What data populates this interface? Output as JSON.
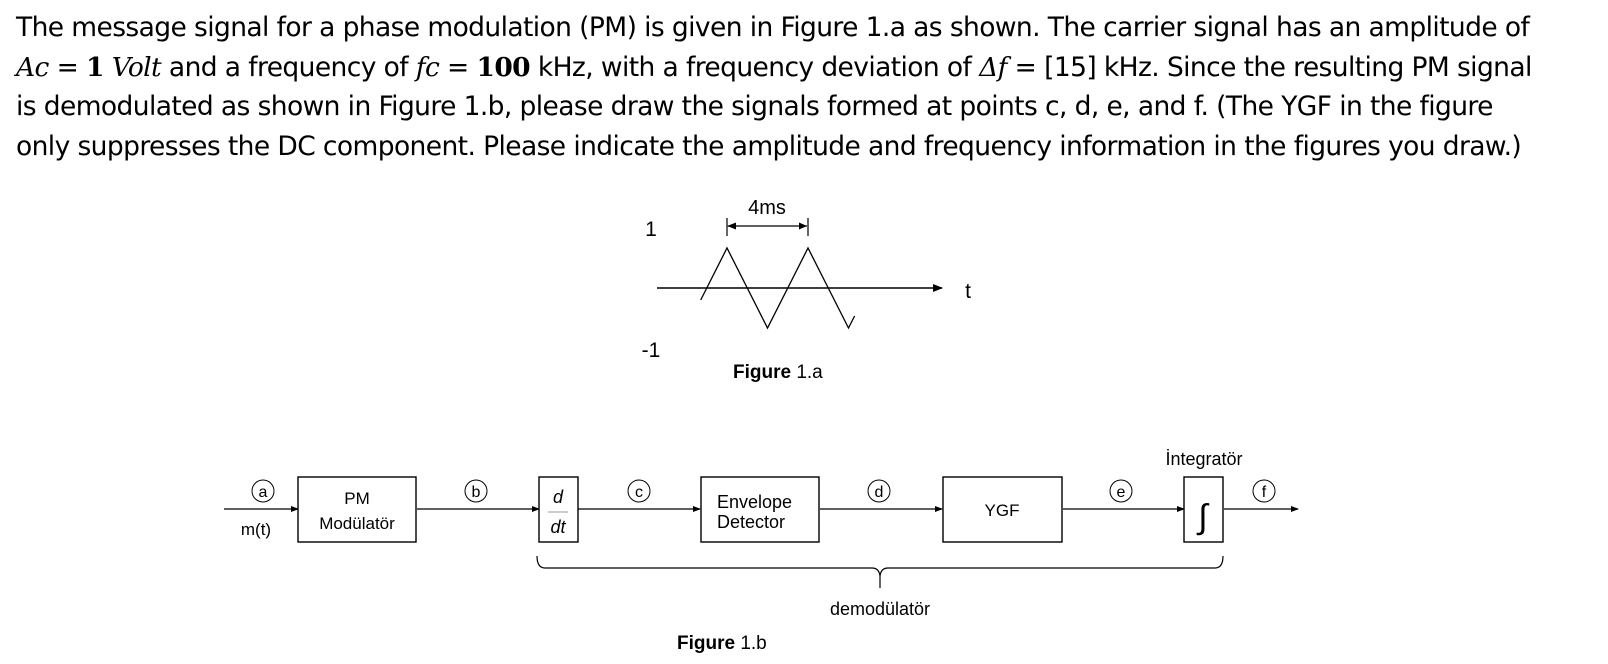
{
  "problem": {
    "line1": "The message signal for a phase modulation (PM) is given in Figure 1.a as shown. The carrier signal has an amplitude of",
    "line2": {
      "ac_symbol": "Ac",
      "eq1": " = ",
      "ac_value": "1",
      "ac_unit": " Volt",
      "text_a": " and a frequency of ",
      "fc_symbol": "fc",
      "eq2": " = ",
      "fc_value": "100",
      "text_b": " kHz, with a frequency deviation of ",
      "df_symbol": "Δf",
      "text_c": " = [15] kHz. Since the resulting PM signal"
    },
    "line3": "is demodulated as shown in Figure 1.b, please draw the signals formed at points c, d, e, and f. (The YGF in the figure",
    "line4": "only suppresses the DC component. Please indicate the amplitude and frequency information in the figures you draw.)"
  },
  "figure_1a": {
    "caption_bold": "Figure",
    "caption_rest": " 1.a",
    "period_label": "4ms",
    "y_max_label": "1",
    "y_min_label": "-1",
    "x_axis_label": "t",
    "waveform": "triangle",
    "amplitude": 1,
    "period_ms": 4
  },
  "figure_1b": {
    "caption_bold": "Figure",
    "caption_rest": " 1.b",
    "input_label": "m(t)",
    "points": [
      "a",
      "b",
      "c",
      "d",
      "e",
      "f"
    ],
    "blocks": {
      "pm_modulator": [
        "PM",
        "Modülatör"
      ],
      "differentiator": [
        "d",
        "dt"
      ],
      "envelope_detector": [
        "Envelope",
        "Detector"
      ],
      "ygf": "YGF",
      "integrator_title": "İntegratör",
      "integrator_symbol": "∫"
    },
    "brace_label": "demodülatör"
  }
}
